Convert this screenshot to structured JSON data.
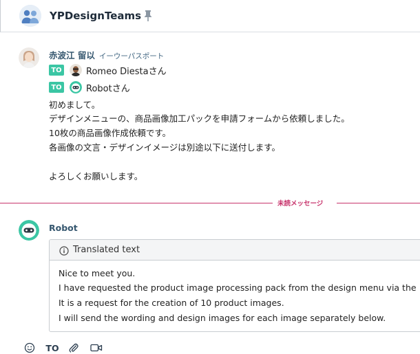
{
  "header": {
    "room_title": "YPDesignTeams",
    "avatar_icon": "group-avatar-icon",
    "pin_icon": "pin-icon"
  },
  "message1": {
    "sender_name": "赤波江 留以",
    "sender_org": "イーウーパスポート",
    "to": [
      {
        "badge": "TO",
        "name": "Romeo Diestaさん"
      },
      {
        "badge": "TO",
        "name": "Robotさん"
      }
    ],
    "lines": [
      "初めまして。",
      "デザインメニューの、商品画像加工パックを申請フォームから依頼しました。",
      "10枚の商品画像作成依頼です。",
      "各画像の文言・デザインイメージは別途以下に送付します。",
      "",
      "よろしくお願いします。"
    ]
  },
  "divider": {
    "label": "未読メッセージ",
    "color": "#c7336b"
  },
  "message2": {
    "sender_name": "Robot",
    "translation_title": "Translated text",
    "lines": [
      "Nice to meet you.",
      "I have requested the product image processing pack from the design menu via the",
      "It is a request for the creation of 10 product images.",
      "I will send the wording and design images for each image separately below."
    ]
  },
  "composer": {
    "to_label": "TO",
    "tools": [
      "emoji-icon",
      "paperclip-icon",
      "video-icon"
    ]
  },
  "colors": {
    "to_badge": "#3bc6a4",
    "sender": "#36576f"
  }
}
